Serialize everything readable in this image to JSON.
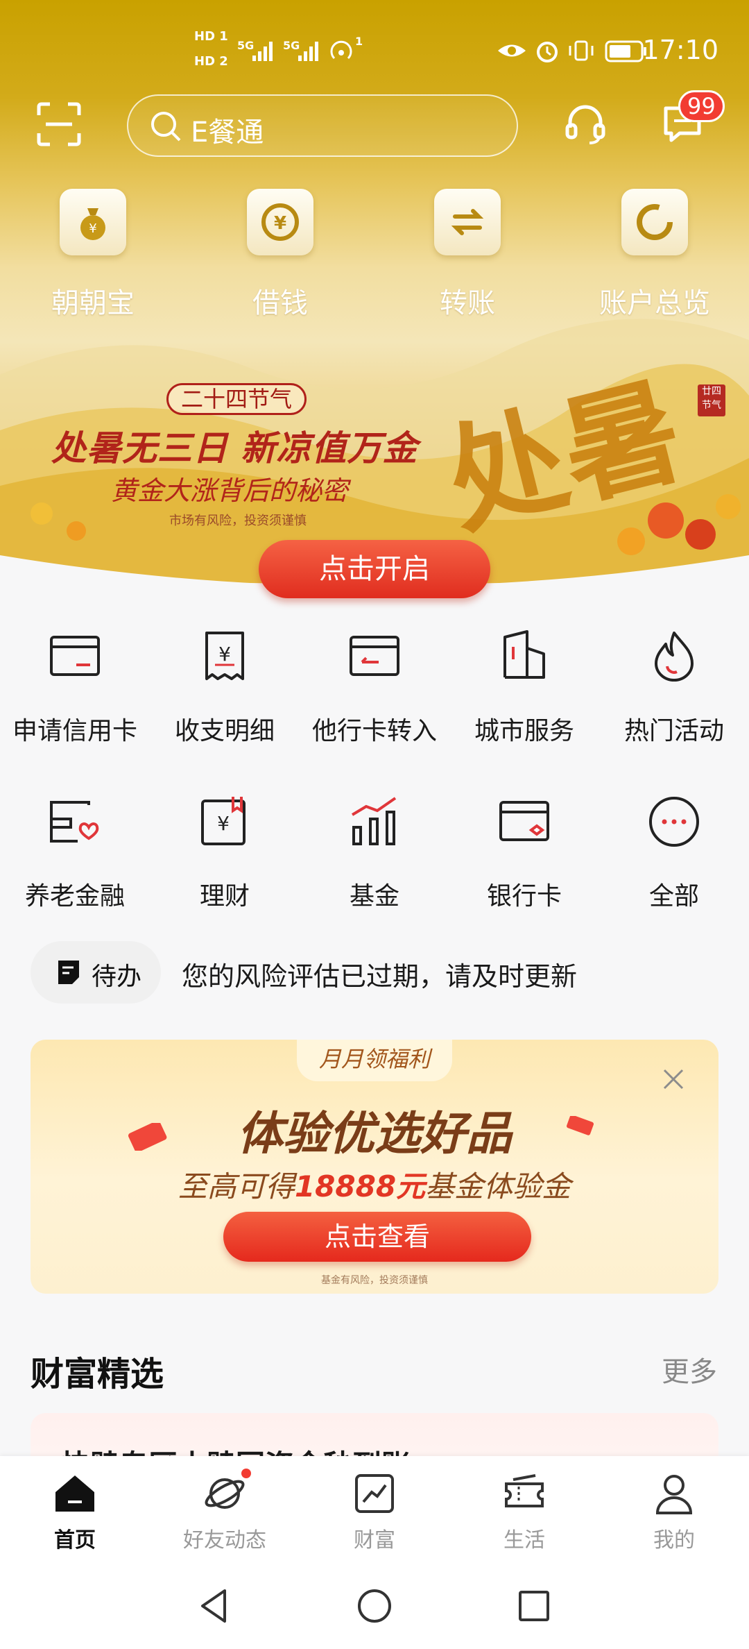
{
  "status_bar": {
    "sim1": "HD 1",
    "sim2": "HD 2",
    "net1": "5G",
    "net2": "5G",
    "hotspot": "1",
    "time": "17:10"
  },
  "header": {
    "search_placeholder": "E餐通",
    "message_badge": "99"
  },
  "quick_actions": [
    {
      "label": "朝朝宝",
      "icon": "money-bag-icon"
    },
    {
      "label": "借钱",
      "icon": "yuan-coin-icon"
    },
    {
      "label": "转账",
      "icon": "transfer-arrows-icon"
    },
    {
      "label": "账户总览",
      "icon": "ring-chart-icon"
    }
  ],
  "banner": {
    "tag": "二十四节气",
    "headline": "处暑无三日 新凉值万金",
    "subline": "黄金大涨背后的秘密",
    "risk": "市场有风险，投资须谨慎",
    "big_text": "处暑",
    "seal": "廿四节气",
    "cta": "点击开启"
  },
  "grid_row1": [
    {
      "label": "申请信用卡",
      "icon": "credit-card-icon"
    },
    {
      "label": "收支明细",
      "icon": "receipt-icon"
    },
    {
      "label": "他行卡转入",
      "icon": "card-transfer-icon"
    },
    {
      "label": "城市服务",
      "icon": "city-buildings-icon"
    },
    {
      "label": "热门活动",
      "icon": "flame-icon"
    }
  ],
  "grid_row2": [
    {
      "label": "养老金融",
      "icon": "pension-card-heart-icon"
    },
    {
      "label": "理财",
      "icon": "yuan-bookmark-icon"
    },
    {
      "label": "基金",
      "icon": "bar-chart-trend-icon"
    },
    {
      "label": "银行卡",
      "icon": "bank-card-icon"
    },
    {
      "label": "全部",
      "icon": "more-dots-icon"
    }
  ],
  "todo": {
    "label": "待办",
    "message": "您的风险评估已过期，请及时更新"
  },
  "promo": {
    "tab": "月月领福利",
    "title": "体验优选好品",
    "sub_prefix": "至高可得",
    "amount": "18888元",
    "sub_suffix": "基金体验金",
    "button": "点击查看",
    "risk": "基金有风险，投资须谨慎"
  },
  "wealth": {
    "title": "财富精选",
    "more": "更多",
    "card_title": "快赎专区丨赎回资金秒到账"
  },
  "tabbar": [
    {
      "label": "首页",
      "icon": "home-icon",
      "active": true
    },
    {
      "label": "好友动态",
      "icon": "planet-icon",
      "active": false
    },
    {
      "label": "财富",
      "icon": "trend-chart-icon",
      "active": false
    },
    {
      "label": "生活",
      "icon": "ticket-icon",
      "active": false
    },
    {
      "label": "我的",
      "icon": "user-icon",
      "active": false
    }
  ],
  "colors": {
    "brand_gold": "#c9a100",
    "accent_red": "#e02d1f",
    "icon_red": "#e0363a"
  }
}
